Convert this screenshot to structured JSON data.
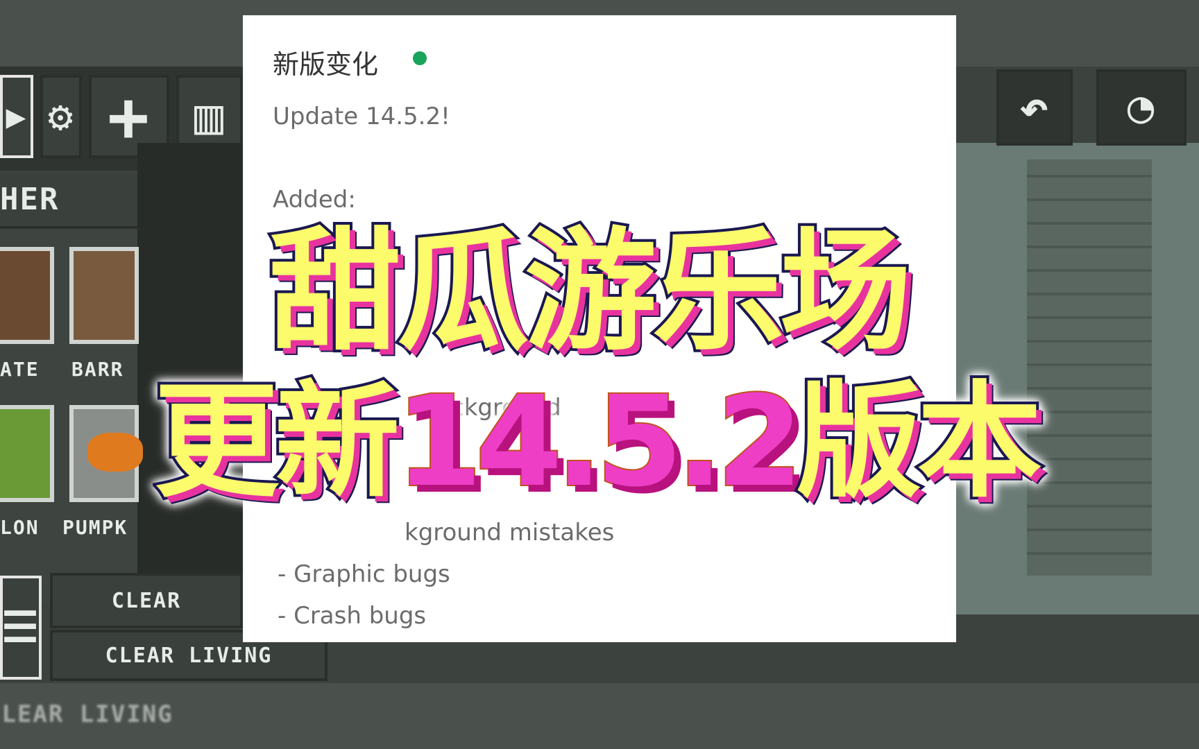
{
  "panel": {
    "title": "新版变化",
    "status_color": "#1aa35a",
    "version_line": "Update 14.5.2!",
    "added_label": "Added:",
    "lines": [
      "ckground",
      "kground mistakes",
      "- Graphic bugs",
      "- Crash bugs"
    ]
  },
  "overlay": {
    "line1": "甜瓜游乐场",
    "line2_a": "更新",
    "line2_version": "14.5.2",
    "line2_b": "版本",
    "colors": {
      "yellow": "#fbfb6c",
      "pink": "#ee3ec6",
      "outline": "#1a1850"
    }
  },
  "game": {
    "category": "HER",
    "items": [
      "ATE",
      "BARR",
      "LON",
      "PUMPK"
    ],
    "clear_label": "CLEAR",
    "clear_living": "CLEAR LIVING",
    "clear_living_2": "CLEAR LIVING",
    "icons": [
      "play-icon",
      "gear-icon",
      "plus-icon",
      "layout-icon",
      "undo-icon",
      "slow-motion-icon"
    ]
  }
}
